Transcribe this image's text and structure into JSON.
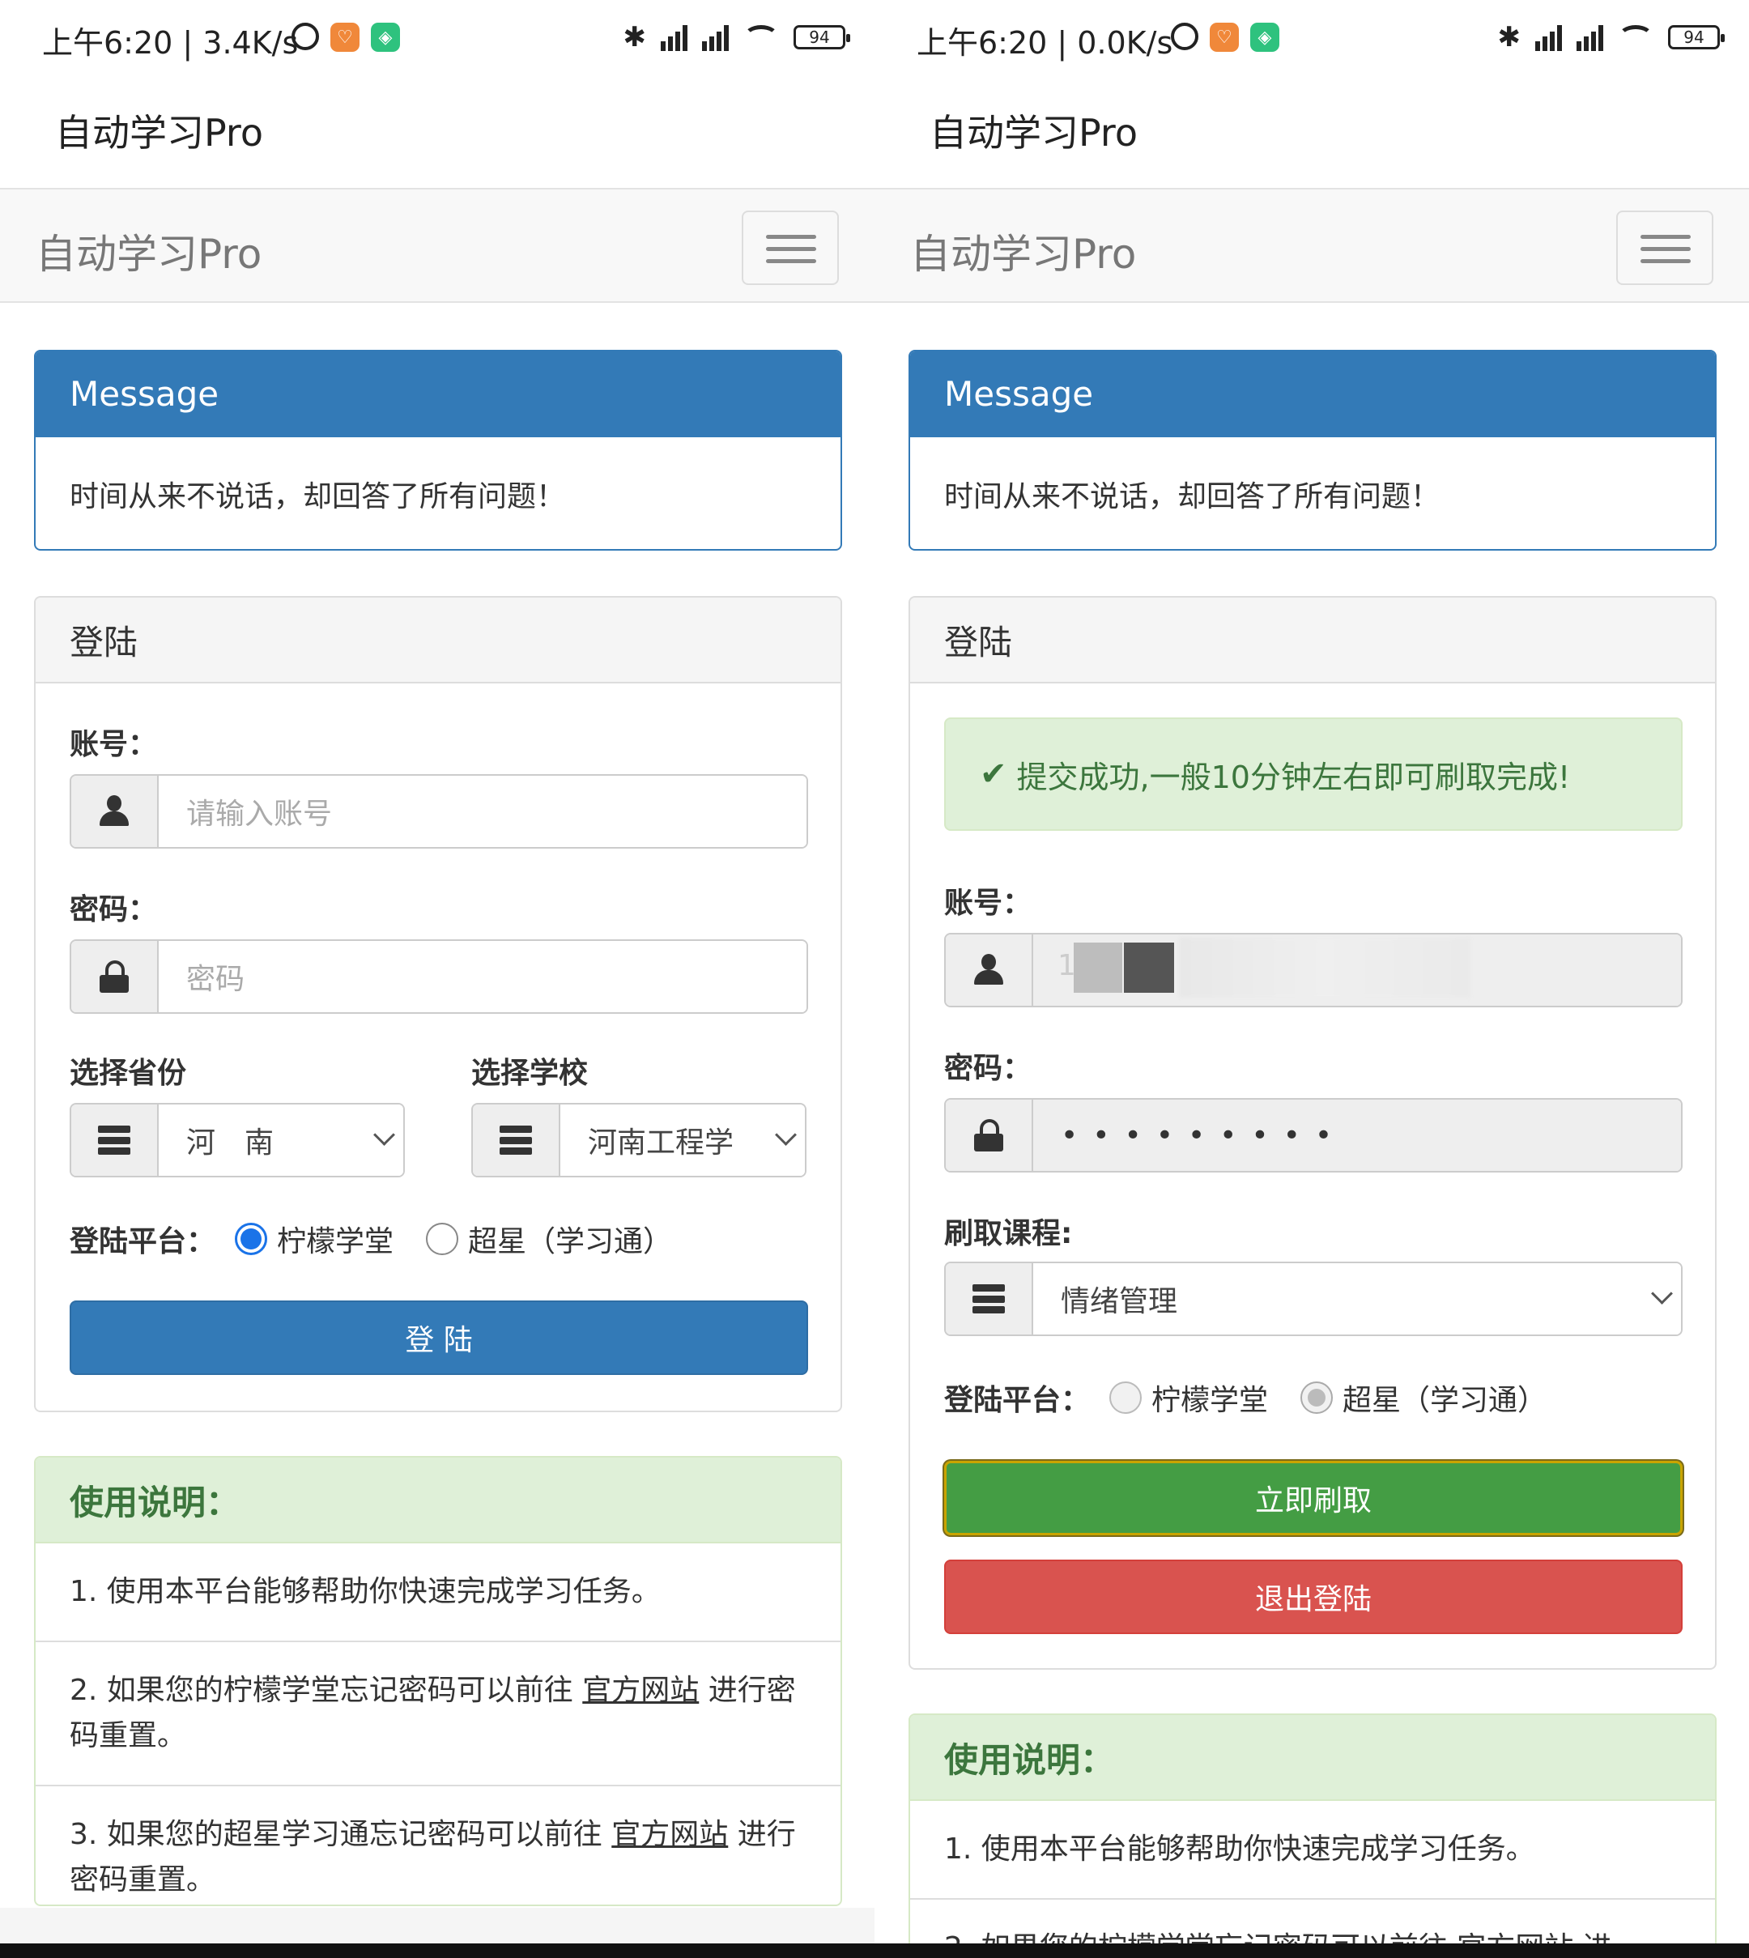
{
  "left": {
    "status": {
      "time": "上午6:20 | 3.4K/s",
      "battery": "94"
    },
    "app_title": "自动学习Pro",
    "navbar": {
      "brand": "自动学习Pro"
    },
    "message": {
      "title": "Message",
      "body": "时间从来不说话，却回答了所有问题！"
    },
    "login": {
      "title": "登陆",
      "account_label": "账号：",
      "account_placeholder": "请输入账号",
      "password_label": "密码：",
      "password_placeholder": "密码",
      "province_label": "选择省份",
      "province_value": "河　南",
      "school_label": "选择学校",
      "school_value": "河南工程学",
      "platform_label": "登陆平台：",
      "platform_option1": "柠檬学堂",
      "platform_option2": "超星（学习通）",
      "submit": "登 陆"
    },
    "instructions": {
      "title": "使用说明：",
      "item1": "1. 使用本平台能够帮助你快速完成学习任务。",
      "item2_pre": "2. 如果您的柠檬学堂忘记密码可以前往 ",
      "item2_link": "官方网站",
      "item2_post": " 进行密码重置。",
      "item3_pre": "3. 如果您的超星学习通忘记密码可以前往 ",
      "item3_link": "官方网站",
      "item3_post": " 进行密码重置。"
    }
  },
  "right": {
    "status": {
      "time": "上午6:20 | 0.0K/s",
      "battery": "94"
    },
    "app_title": "自动学习Pro",
    "navbar": {
      "brand": "自动学习Pro"
    },
    "message": {
      "title": "Message",
      "body": "时间从来不说话，却回答了所有问题！"
    },
    "login": {
      "title": "登陆",
      "alert": "提交成功,一般10分钟左右即可刷取完成!",
      "account_label": "账号：",
      "account_value": "1",
      "password_label": "密码：",
      "password_value": "•••••••••",
      "course_label": "刷取课程:",
      "course_value": "情绪管理",
      "platform_label": "登陆平台：",
      "platform_option1": "柠檬学堂",
      "platform_option2": "超星（学习通）",
      "start_button": "立即刷取",
      "logout_button": "退出登陆"
    },
    "instructions": {
      "title": "使用说明：",
      "item1": "1. 使用本平台能够帮助你快速完成学习任务。",
      "item2_partial": "2. 如果您的柠檬学堂忘记密码可以前往 官方网站 进"
    }
  },
  "colors": {
    "primary": "#337ab7",
    "success_bg": "#dff0d8",
    "success_text": "#3c763d",
    "green_button": "#449d44",
    "red_button": "#d9534f",
    "radio_checked": "#1a73e8"
  }
}
